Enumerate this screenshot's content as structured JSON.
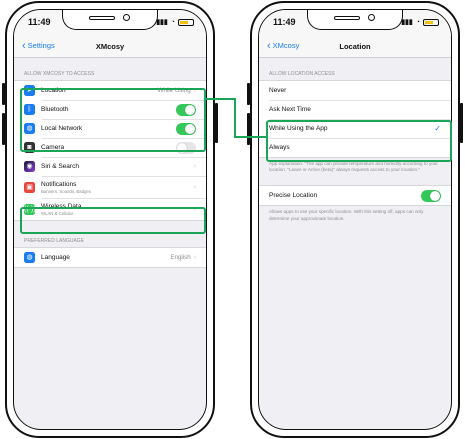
{
  "colors": {
    "accent": "#1a7cf2",
    "highlight": "#1aa559",
    "toggle_on": "#34c759"
  },
  "left": {
    "status": {
      "time": "11:49"
    },
    "nav": {
      "back": "Settings",
      "title": "XMcosy"
    },
    "section1": "ALLOW XMCOSY TO ACCESS",
    "rows": [
      {
        "label": "Location",
        "value": "While Using",
        "icon": "location-icon",
        "color": "#1a7cf2"
      },
      {
        "label": "Bluetooth",
        "icon": "bluetooth-icon",
        "color": "#1a7cf2",
        "toggle": "on"
      },
      {
        "label": "Local Network",
        "icon": "globe-icon",
        "color": "#1a7cf2",
        "toggle": "on"
      },
      {
        "label": "Camera",
        "icon": "camera-icon",
        "color": "#333333",
        "toggle": "off"
      },
      {
        "label": "Siri & Search",
        "icon": "siri-icon",
        "color": "#4a3aa8"
      },
      {
        "label": "Notifications",
        "sub": "Banners, Sounds, Badges",
        "icon": "bell-icon",
        "color": "#e8453c"
      },
      {
        "label": "Wireless Data",
        "sub": "WLAN & Cellular",
        "icon": "antenna-icon",
        "color": "#34c759"
      }
    ],
    "section2": "PREFERRED LANGUAGE",
    "language": {
      "label": "Language",
      "value": "English",
      "icon": "globe-icon",
      "color": "#1a7cf2"
    }
  },
  "right": {
    "status": {
      "time": "11:49"
    },
    "nav": {
      "back": "XMcosy",
      "title": "Location"
    },
    "section1": "ALLOW LOCATION ACCESS",
    "options": [
      "Never",
      "Ask Next Time",
      "While Using the App",
      "Always"
    ],
    "selected_index": 2,
    "explanation": "App explanation: \"The app can provide temperature and humidity according to your location. \"Leave or Arrive (beta)\" always requests access to your location.\"",
    "precise": {
      "label": "Precise Location",
      "toggle": "on"
    },
    "precise_note": "Allows apps to use your specific location. With this setting off, apps can only determine your approximate location."
  }
}
